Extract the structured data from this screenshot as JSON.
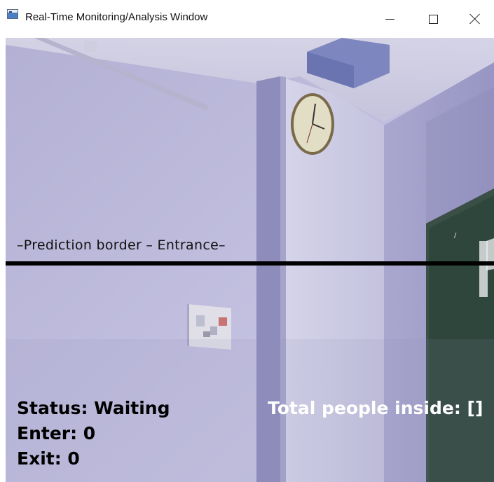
{
  "window": {
    "title": "Real-Time Monitoring/Analysis Window",
    "controls": {
      "minimize": "–",
      "maximize": "☐",
      "close": "✕"
    }
  },
  "frame": {
    "border_label": "–Prediction border – Entrance–",
    "status": "Status: Waiting",
    "enter": "Enter: 0",
    "exit": "Exit: 0",
    "total_inside": "Total people inside: []"
  },
  "icons": [
    "app-icon",
    "minimize-icon",
    "maximize-icon",
    "close-icon"
  ]
}
